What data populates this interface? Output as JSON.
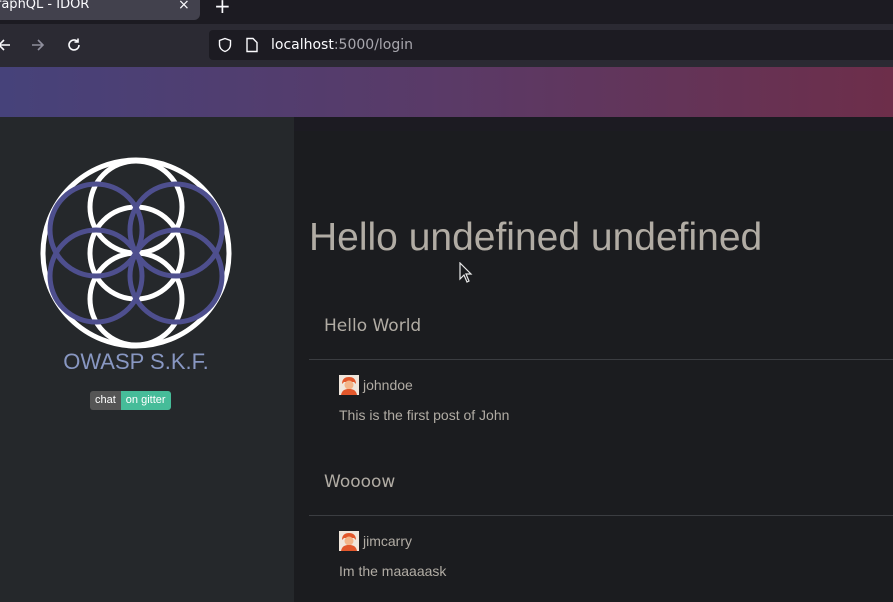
{
  "browser": {
    "tab_title": "raphQL - IDOR",
    "tab_close": "×",
    "new_tab": "+",
    "url_host": "localhost",
    "url_rest": ":5000/login"
  },
  "sidebar": {
    "brand": "OWASP S.K.F.",
    "badge_left": "chat",
    "badge_right": "on gitter"
  },
  "main": {
    "greeting": "Hello undefined undefined",
    "posts": [
      {
        "title": "Hello World",
        "author": "johndoe",
        "body": "This is the first post of John"
      },
      {
        "title": "Woooow",
        "author": "jimcarry",
        "body": "Im the maaaaask"
      }
    ]
  },
  "colors": {
    "chrome_bg": "#2b2a33",
    "banner_start": "#46427a",
    "banner_end": "#6d2e4a",
    "sidebar_bg": "#25282b",
    "main_bg": "#1b1c1f",
    "brand_text": "#8897c2",
    "body_text": "#b1aca4",
    "gitter_green": "#46bc99"
  },
  "icons": [
    "back-arrow-icon",
    "forward-arrow-icon",
    "reload-icon",
    "shield-icon",
    "page-icon",
    "logo-icon",
    "avatar-icon",
    "mouse-cursor-icon"
  ]
}
